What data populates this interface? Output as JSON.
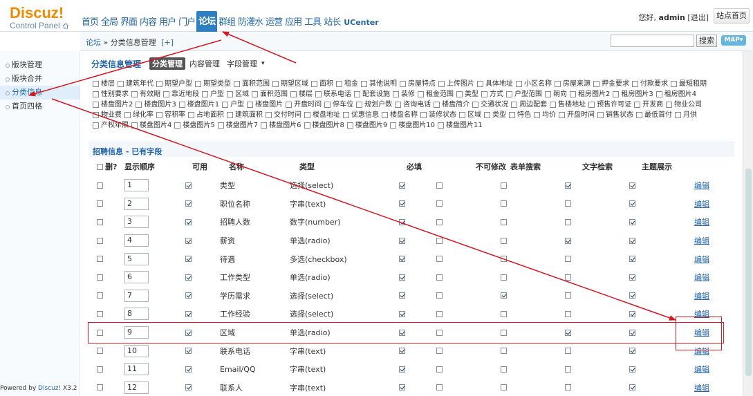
{
  "logo": {
    "brand": "Discuz!",
    "subtitle": "Control Panel"
  },
  "topnav": [
    {
      "label": "首页",
      "small": false
    },
    {
      "label": "全局",
      "small": false
    },
    {
      "label": "界面",
      "small": false
    },
    {
      "label": "内容",
      "small": false
    },
    {
      "label": "用户",
      "small": false
    },
    {
      "label": "门户",
      "small": false
    },
    {
      "label": "论坛",
      "small": false,
      "active": true
    },
    {
      "label": "群组",
      "small": false
    },
    {
      "label": "防灌水",
      "small": false
    },
    {
      "label": "运营",
      "small": false
    },
    {
      "label": "应用",
      "small": false
    },
    {
      "label": "工具",
      "small": false
    },
    {
      "label": "站长",
      "small": false
    },
    {
      "label": "UCenter",
      "small": true
    }
  ],
  "user": {
    "greeting": "您好,",
    "name": "admin",
    "logout": "[退出]",
    "sitehome": "站点首页"
  },
  "breadcrumb": {
    "root": "论坛",
    "sep": " » ",
    "current": "分类信息管理",
    "add": "[+]"
  },
  "search": {
    "button": "搜索",
    "map": "MAP"
  },
  "sidebar": [
    {
      "label": "版块管理"
    },
    {
      "label": "版块合并"
    },
    {
      "label": "分类信息",
      "active": true
    },
    {
      "label": "首页四格"
    }
  ],
  "footer": {
    "prefix": "Powered by ",
    "brand": "Discuz!",
    "version": " X3.2"
  },
  "tabs": {
    "title": "分类信息管理",
    "items": [
      "分类管理",
      "内容管理",
      "字段管理"
    ],
    "active": 0
  },
  "field_tags": [
    [
      "楼层",
      "建筑年代",
      "期望户型",
      "期望类型",
      "面积范围",
      "期望区域",
      "面积",
      "租金",
      "其他说明",
      "房屋特点",
      "上传图片",
      "具体地址",
      "小区名称",
      "房屋来源",
      "押金要求",
      "付款要求",
      "最短租期"
    ],
    [
      "性别要求",
      "有效期",
      "靠近地段",
      "户型",
      "区域",
      "面积范围",
      "楼层",
      "联系电话",
      "配套设施",
      "装修",
      "租金范围",
      "类型",
      "方式",
      "户型范围",
      "朝向",
      "租房图片2",
      "租房图片3",
      "租房图片4"
    ],
    [
      "楼盘图片2",
      "楼盘图片3",
      "楼盘图片1",
      "户型",
      "楼盘图片",
      "开盘时间",
      "停车位",
      "规划户数",
      "咨询电话",
      "楼盘简介",
      "交通状况",
      "周边配套",
      "售楼地址",
      "预售许可证",
      "开发商",
      "物业公司"
    ],
    [
      "物业费",
      "绿化率",
      "容积率",
      "占地面积",
      "建筑面积",
      "交付时间",
      "楼盘地址",
      "优惠信息",
      "楼盘名称",
      "装修状态",
      "区域",
      "类型",
      "特色",
      "均价",
      "开盘时间",
      "销售状态",
      "最低首付",
      "月供"
    ],
    [
      "产权年限",
      "楼盘图片4",
      "楼盘图片5",
      "楼盘图片7",
      "楼盘图片6",
      "楼盘图片8",
      "楼盘图片9",
      "楼盘图片10",
      "楼盘图片11"
    ]
  ],
  "section_title": "招聘信息 - 已有字段",
  "columns": [
    "删?",
    "显示顺序",
    "可用",
    "名称",
    "类型",
    "必填",
    "不可修改",
    "表单搜索",
    "文字检索",
    "主题展示",
    ""
  ],
  "edit_label": "编辑",
  "rows": [
    {
      "order": "1",
      "name": "类型",
      "type": "选择(select)",
      "avail": true,
      "req": true,
      "nomod": false,
      "form": false,
      "text": true,
      "show": true
    },
    {
      "order": "2",
      "name": "职位名称",
      "type": "字串(text)",
      "avail": true,
      "req": true,
      "nomod": false,
      "form": false,
      "text": false,
      "show": true
    },
    {
      "order": "3",
      "name": "招聘人数",
      "type": "数字(number)",
      "avail": true,
      "req": true,
      "nomod": false,
      "form": false,
      "text": false,
      "show": true
    },
    {
      "order": "4",
      "name": "薪资",
      "type": "单选(radio)",
      "avail": true,
      "req": true,
      "nomod": false,
      "form": false,
      "text": true,
      "show": true
    },
    {
      "order": "5",
      "name": "待遇",
      "type": "多选(checkbox)",
      "avail": true,
      "req": true,
      "nomod": false,
      "form": false,
      "text": false,
      "show": true
    },
    {
      "order": "6",
      "name": "工作类型",
      "type": "单选(radio)",
      "avail": true,
      "req": true,
      "nomod": false,
      "form": false,
      "text": false,
      "show": true
    },
    {
      "order": "7",
      "name": "学历需求",
      "type": "选择(select)",
      "avail": true,
      "req": true,
      "nomod": false,
      "form": true,
      "text": false,
      "show": true
    },
    {
      "order": "8",
      "name": "工作经验",
      "type": "选择(select)",
      "avail": true,
      "req": true,
      "nomod": false,
      "form": false,
      "text": false,
      "show": true
    },
    {
      "order": "9",
      "name": "区域",
      "type": "单选(radio)",
      "avail": true,
      "req": true,
      "nomod": false,
      "form": false,
      "text": true,
      "show": true
    },
    {
      "order": "10",
      "name": "联系电话",
      "type": "字串(text)",
      "avail": true,
      "req": true,
      "nomod": false,
      "form": false,
      "text": false,
      "show": true
    },
    {
      "order": "11",
      "name": "Email/QQ",
      "type": "字串(text)",
      "avail": true,
      "req": true,
      "nomod": false,
      "form": false,
      "text": false,
      "show": true
    },
    {
      "order": "12",
      "name": "联系人",
      "type": "字串(text)",
      "avail": true,
      "req": true,
      "nomod": false,
      "form": false,
      "text": false,
      "show": true
    }
  ],
  "annotation_color": "#d9151e"
}
